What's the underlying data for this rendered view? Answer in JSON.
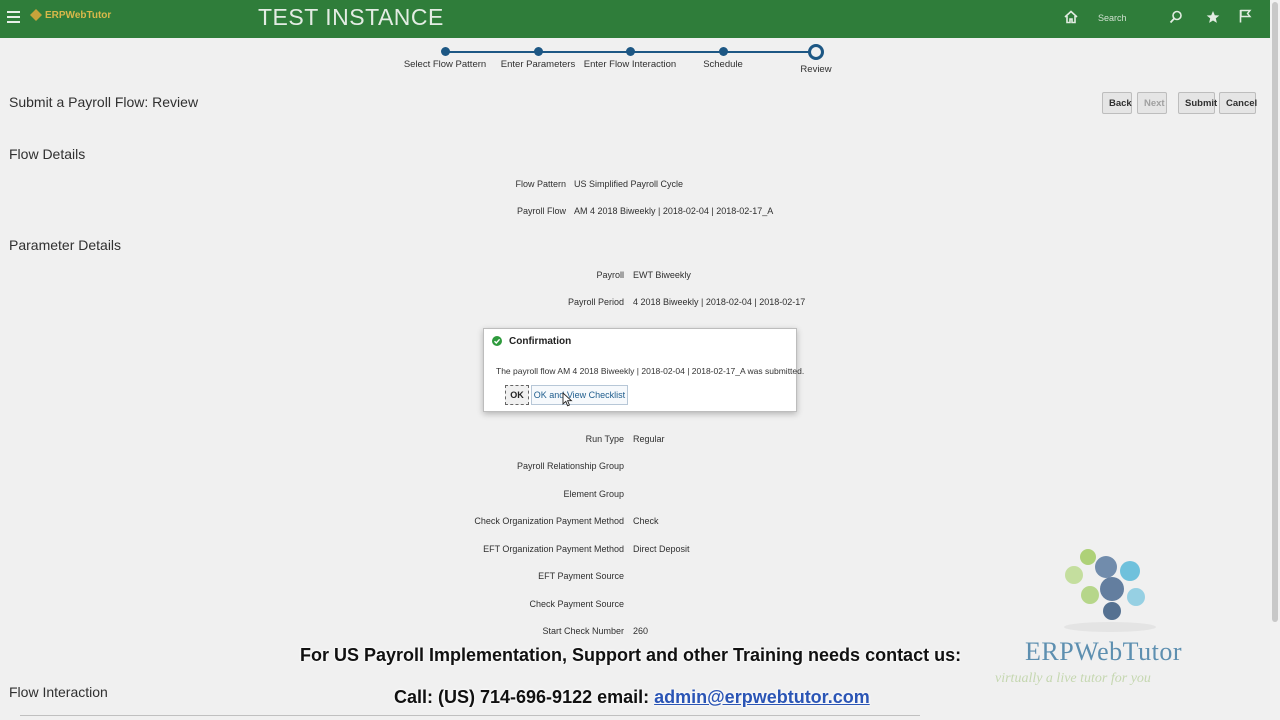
{
  "header": {
    "logo_text": "ERPWebTutor",
    "instance_label": "TEST INSTANCE",
    "search_placeholder": "Search"
  },
  "train": {
    "steps": [
      {
        "label": "Select Flow Pattern",
        "state": "completed"
      },
      {
        "label": "Enter Parameters",
        "state": "completed"
      },
      {
        "label": "Enter Flow Interaction",
        "state": "completed"
      },
      {
        "label": "Schedule",
        "state": "completed"
      },
      {
        "label": "Review",
        "state": "current"
      }
    ]
  },
  "page": {
    "title": "Submit a Payroll Flow: Review",
    "buttons": {
      "back": "Back",
      "next": "Next",
      "submit": "Submit",
      "cancel": "Cancel"
    }
  },
  "flow_details": {
    "title": "Flow Details",
    "rows": [
      {
        "label": "Flow Pattern",
        "value": "US Simplified Payroll Cycle"
      },
      {
        "label": "Payroll Flow",
        "value": "AM 4 2018 Biweekly | 2018-02-04 | 2018-02-17_A"
      }
    ]
  },
  "parameter_details": {
    "title": "Parameter Details",
    "rows": [
      {
        "label": "Payroll",
        "value": "EWT Biweekly"
      },
      {
        "label": "Payroll Period",
        "value": "4 2018 Biweekly | 2018-02-04 | 2018-02-17"
      },
      {
        "label": "Run Type",
        "value": "Regular"
      },
      {
        "label": "Payroll Relationship Group",
        "value": ""
      },
      {
        "label": "Element Group",
        "value": ""
      },
      {
        "label": "Check Organization Payment Method",
        "value": "Check"
      },
      {
        "label": "EFT Organization Payment Method",
        "value": "Direct Deposit"
      },
      {
        "label": "EFT Payment Source",
        "value": ""
      },
      {
        "label": "Check Payment Source",
        "value": ""
      },
      {
        "label": "Start Check Number",
        "value": "260"
      }
    ]
  },
  "flow_interaction": {
    "title": "Flow Interaction"
  },
  "dialog": {
    "title": "Confirmation",
    "message": "The payroll flow AM 4 2018 Biweekly | 2018-02-04 | 2018-02-17_A was submitted.",
    "ok_label": "OK",
    "ok_view_label": "OK and View Checklist"
  },
  "promo": {
    "line1": "For US Payroll Implementation, Support and other Training needs contact us:",
    "line2_prefix": "Call: (US) 714-696-9122 email: ",
    "email": "admin@erpwebtutor.com"
  },
  "brand": {
    "name": "ERPWebTutor",
    "tagline": "virtually a live tutor for you"
  },
  "colors": {
    "header": "#2f7d3a",
    "train": "#1f5d8d",
    "success": "#2e9a3c"
  }
}
